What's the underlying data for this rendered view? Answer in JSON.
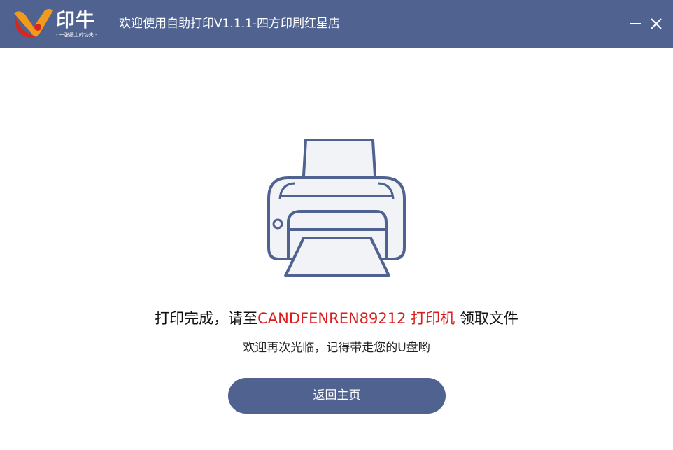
{
  "titlebar": {
    "logo_text": "印牛",
    "logo_slogan": "- 一张纸上的功夫 -",
    "title": "欢迎使用自助打印V1.1.1-四方印刷红星店",
    "background_color": "#4f6290",
    "minimize_icon": "minimize-icon",
    "close_icon": "close-icon"
  },
  "main": {
    "illustration_icon": "printer-icon",
    "status_prefix": "打印完成，请至",
    "printer_name": "CANDFENREN89212 打印机",
    "status_suffix": " 领取文件",
    "accent_color": "#d81e1e",
    "subtitle": "欢迎再次光临，记得带走您的U盘哟",
    "home_button_label": "返回主页"
  }
}
